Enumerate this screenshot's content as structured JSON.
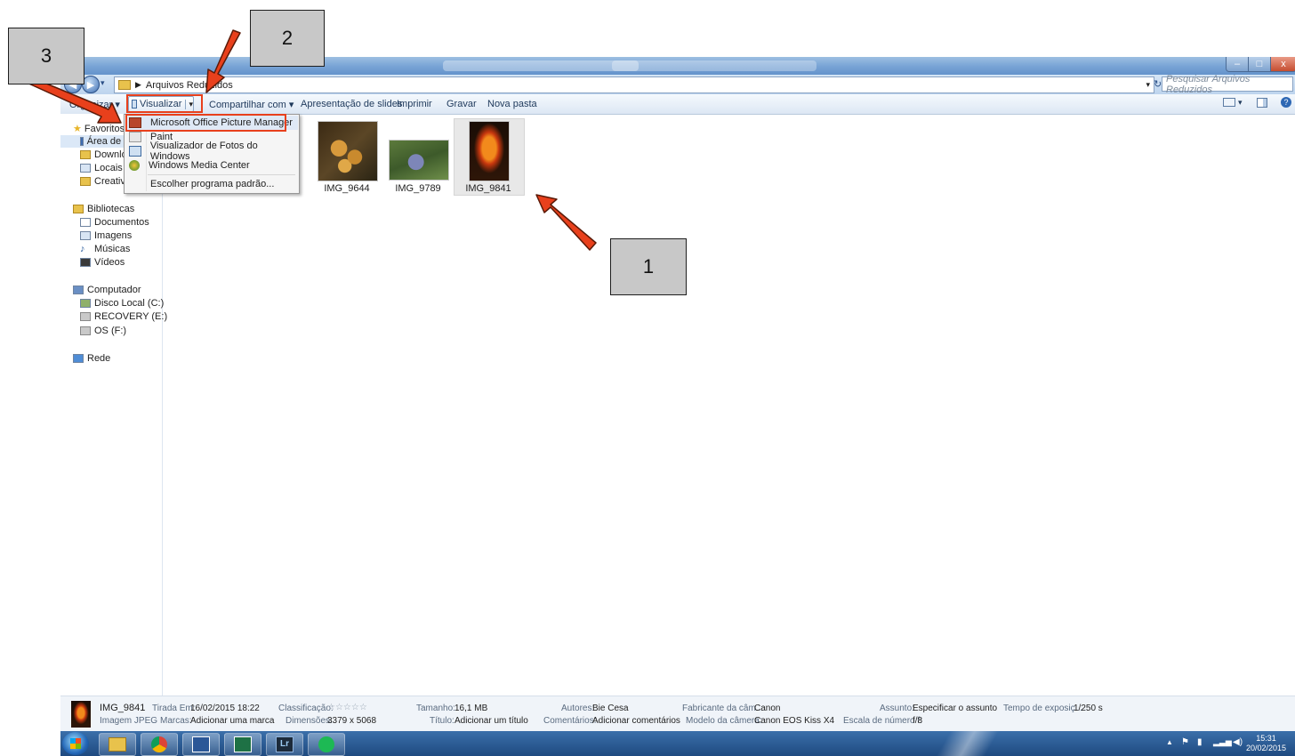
{
  "window": {
    "title": "",
    "controls": {
      "minimize": "–",
      "maximize": "□",
      "close": "x"
    }
  },
  "address": {
    "path": "Arquivos Reduzidos",
    "search_placeholder": "Pesquisar Arquivos Reduzidos"
  },
  "toolbar": {
    "organize": "Organizar ▾",
    "view": "Visualizar",
    "share": "Compartilhar com ▾",
    "slideshow": "Apresentação de slides",
    "print": "Imprimir",
    "burn": "Gravar",
    "new_folder": "Nova pasta"
  },
  "open_with_menu": {
    "items": [
      {
        "label": "Microsoft Office Picture Manager",
        "icon": "picture-manager-icon"
      },
      {
        "label": "Paint",
        "icon": "paint-icon"
      },
      {
        "label": "Visualizador de Fotos do Windows",
        "icon": "photo-viewer-icon"
      },
      {
        "label": "Windows Media Center",
        "icon": "media-center-icon"
      }
    ],
    "choose_default": "Escolher programa padrão..."
  },
  "sidebar": {
    "favorites": "Favoritos",
    "favorite_items": [
      "Área de Trabalho",
      "Downloads",
      "Locais",
      "Creative"
    ],
    "libraries": "Bibliotecas",
    "library_items": [
      "Documentos",
      "Imagens",
      "Músicas",
      "Vídeos"
    ],
    "computer": "Computador",
    "computer_items": [
      "Disco Local (C:)",
      "RECOVERY (E:)",
      "OS (F:)"
    ],
    "network": "Rede"
  },
  "files": [
    {
      "name": "IMG_9644"
    },
    {
      "name": "IMG_9789"
    },
    {
      "name": "IMG_9841"
    }
  ],
  "details": {
    "filename": "IMG_9841",
    "filetype": "Imagem JPEG",
    "taken_label": "Tirada Em:",
    "taken_value": "16/02/2015 18:22",
    "tags_label": "Marcas:",
    "tags_value": "Adicionar uma marca",
    "rating_label": "Classificação:",
    "rating_value": "☆☆☆☆☆",
    "dimensions_label": "Dimensões:",
    "dimensions_value": "3379 x 5068",
    "size_label": "Tamanho:",
    "size_value": "16,1 MB",
    "title_label": "Título:",
    "title_value": "Adicionar um título",
    "authors_label": "Autores:",
    "authors_value": "Bie Cesa",
    "comments_label": "Comentários:",
    "comments_value": "Adicionar comentários",
    "maker_label": "Fabricante da câm...",
    "maker_value": "Canon",
    "model_label": "Modelo da câmera:",
    "model_value": "Canon EOS Kiss X4",
    "subject_label": "Assunto:",
    "subject_value": "Especificar o assunto",
    "fstop_label": "Escala de número f:",
    "fstop_value": "f/8",
    "exposure_label": "Tempo de exposiç...",
    "exposure_value": "1/250 s"
  },
  "taskbar": {
    "apps": [
      "",
      "",
      "",
      "",
      "",
      "Lr",
      ""
    ],
    "time": "15:31",
    "date": "20/02/2015"
  },
  "annotations": {
    "callout_1": "1",
    "callout_2": "2",
    "callout_3": "3",
    "arrow_color": "#e8401c"
  }
}
